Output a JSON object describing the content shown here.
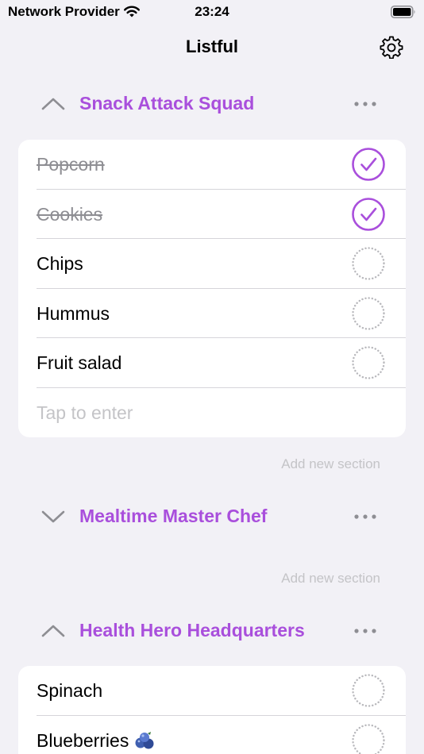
{
  "status_bar": {
    "carrier": "Network Provider",
    "time": "23:24"
  },
  "nav": {
    "title": "Listful",
    "settings_icon": "gear-icon"
  },
  "colors": {
    "accent": "#a94fdc",
    "background": "#f2f1f6",
    "muted": "#c4c4c7"
  },
  "sections": [
    {
      "title": "Snack Attack Squad",
      "expanded": true,
      "items": [
        {
          "label": "Popcorn",
          "done": true
        },
        {
          "label": "Cookies",
          "done": true
        },
        {
          "label": "Chips",
          "done": false
        },
        {
          "label": "Hummus",
          "done": false
        },
        {
          "label": "Fruit salad",
          "done": false
        }
      ],
      "input_placeholder": "Tap to enter",
      "add_section_label": "Add new section"
    },
    {
      "title": "Mealtime Master Chef",
      "expanded": false,
      "add_section_label": "Add new section"
    },
    {
      "title": "Health Hero Headquarters",
      "expanded": true,
      "items": [
        {
          "label": "Spinach",
          "done": false
        },
        {
          "label": "Blueberries",
          "done": false,
          "emoji": "blueberries-icon"
        }
      ]
    }
  ]
}
